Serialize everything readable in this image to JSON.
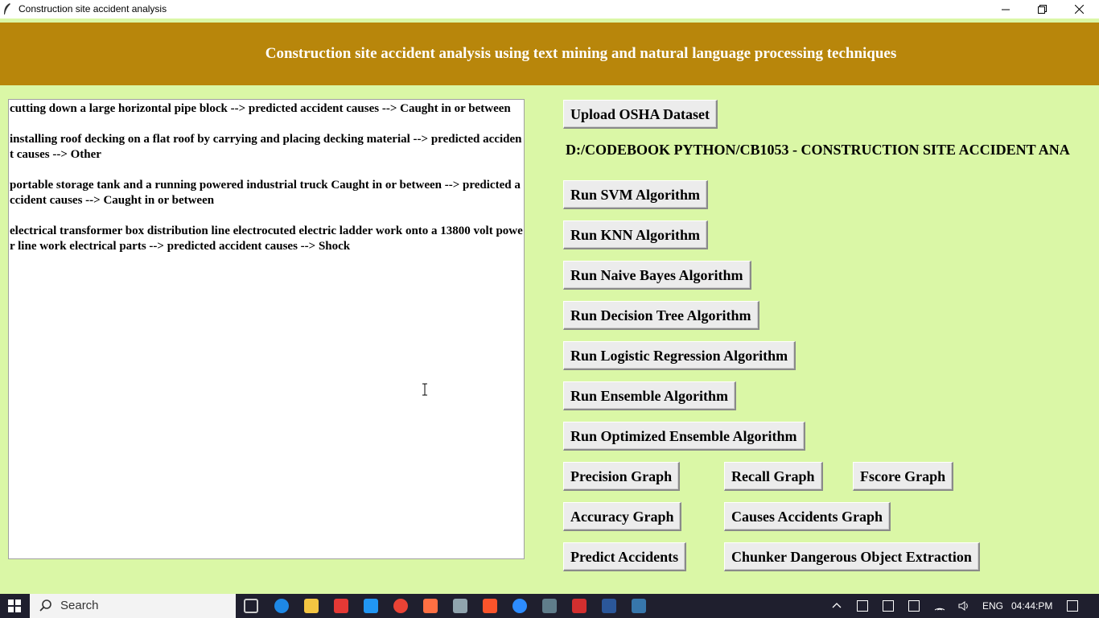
{
  "window": {
    "title": "Construction site accident analysis"
  },
  "banner": {
    "title": "Construction site accident analysis using text mining and natural language processing techniques"
  },
  "output": {
    "entries": [
      "cutting down a large horizontal pipe block --> predicted accident causes --> Caught in or between",
      "installing roof decking on a flat roof by carrying and placing decking material --> predicted accident causes --> Other",
      "portable storage tank and a running powered industrial truck Caught in or between --> predicted accident causes --> Caught in or between",
      "electrical transformer box distribution line electrocuted electric ladder work onto a 13800 volt power line work electrical parts --> predicted accident causes --> Shock"
    ]
  },
  "controls": {
    "upload_label": "Upload OSHA Dataset",
    "path": "D:/CODEBOOK PYTHON/CB1053 - CONSTRUCTION SITE ACCIDENT ANA",
    "svm_label": "Run SVM Algorithm",
    "knn_label": "Run KNN Algorithm",
    "nb_label": "Run Naive Bayes Algorithm",
    "dt_label": "Run Decision Tree Algorithm",
    "lr_label": "Run Logistic Regression Algorithm",
    "ensemble_label": "Run Ensemble Algorithm",
    "opt_ensemble_label": "Run Optimized Ensemble Algorithm",
    "precision_label": "Precision Graph",
    "recall_label": "Recall Graph",
    "fscore_label": "Fscore Graph",
    "accuracy_label": "Accuracy Graph",
    "causes_label": "Causes Accidents Graph",
    "predict_label": "Predict Accidents",
    "chunker_label": "Chunker Dangerous Object Extraction"
  },
  "taskbar": {
    "search_label": "Search",
    "lang": "ENG",
    "time": "04:44:PM"
  },
  "colors": {
    "background": "#daf7a6",
    "banner": "#b8860b",
    "taskbar": "#1f1f2e"
  }
}
